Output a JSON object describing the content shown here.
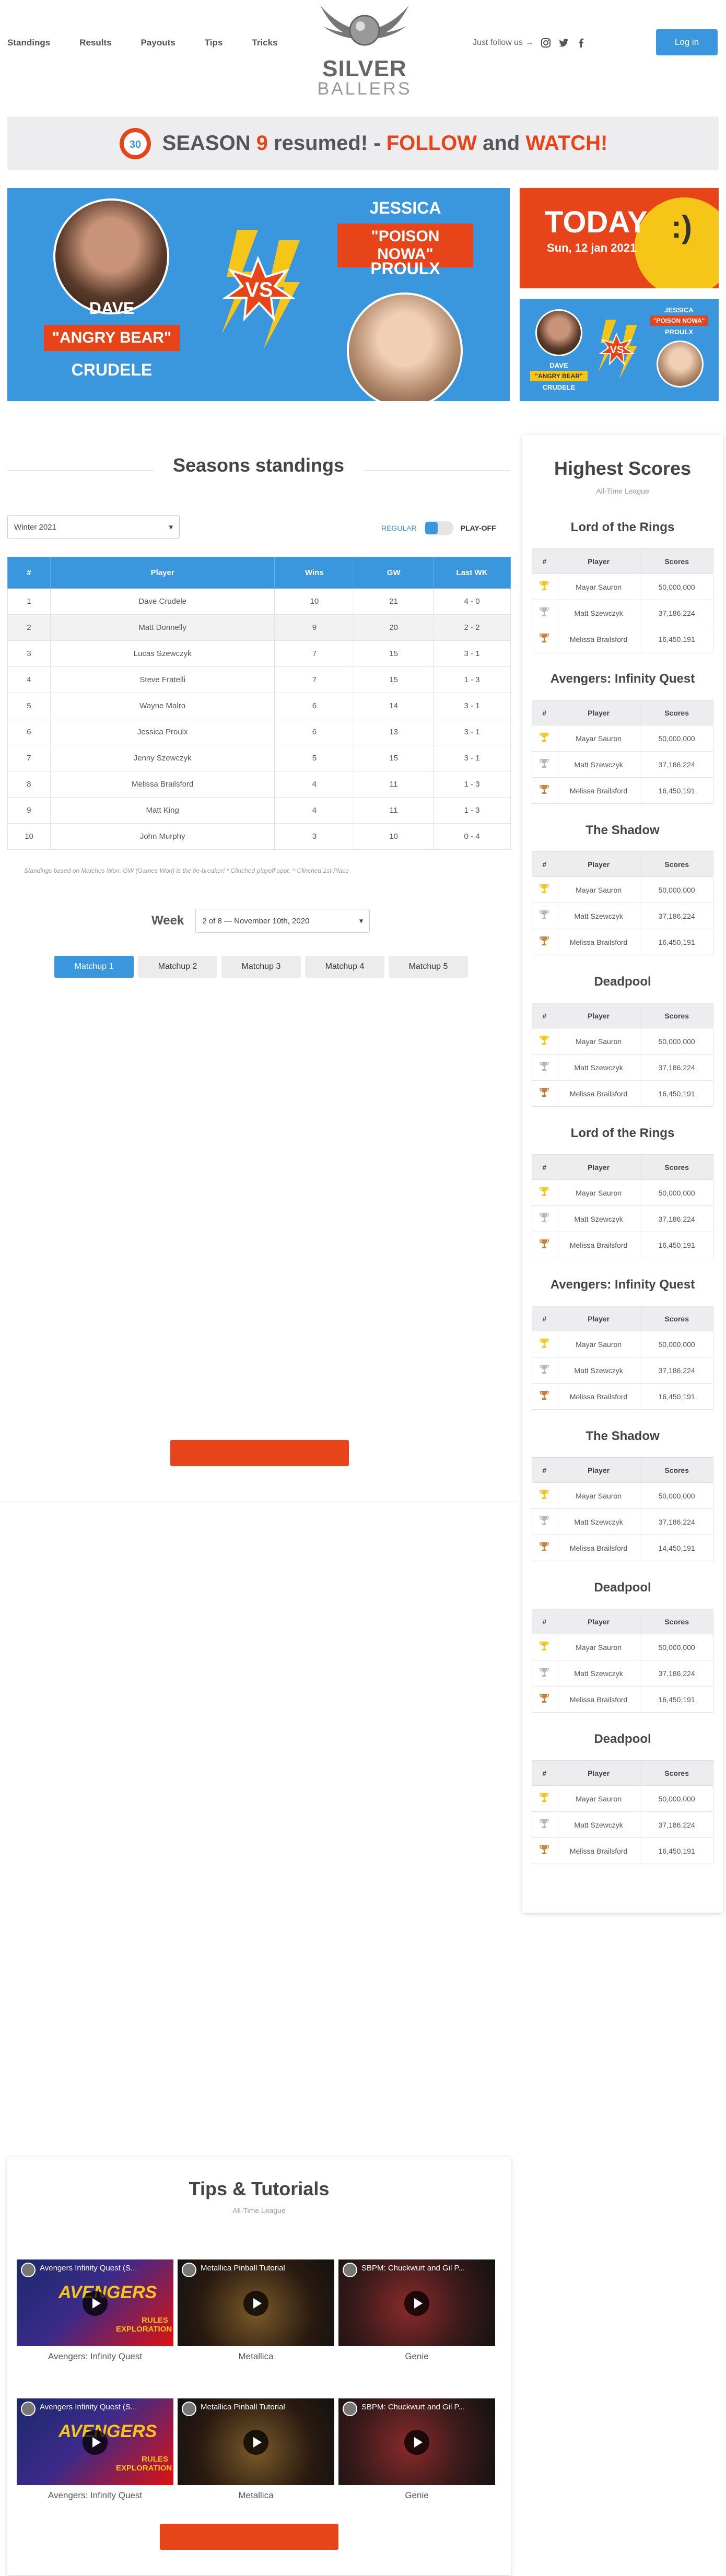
{
  "nav": {
    "items": [
      "Standings",
      "Results",
      "Payouts",
      "Tips",
      "Tricks"
    ]
  },
  "logo": {
    "line1": "SILVER",
    "line2": "BALLERS"
  },
  "header": {
    "follow_label": "Just follow us →",
    "login_label": "Log in",
    "social_icons": [
      "instagram-icon",
      "twitter-icon",
      "facebook-icon"
    ]
  },
  "season": {
    "badge": "30",
    "text_a": "SEASON ",
    "num": "9",
    "text_b": " resumed! - ",
    "follow": "FOLLOW",
    "and": " and ",
    "watch": "WATCH!"
  },
  "versus": {
    "left": {
      "first": "DAVE",
      "nick": "\"ANGRY BEAR\"",
      "last": "CRUDELE"
    },
    "right": {
      "first": "JESSICA",
      "nick": "\"POISON NOWA\"",
      "last": "PROULX"
    },
    "vs": "VS"
  },
  "today": {
    "title": "TODAY",
    "face": ":)",
    "date": "Sun, 12 jan 2021"
  },
  "standings": {
    "title": "Seasons standings",
    "season_select": "Winter 2021",
    "toggle_regular": "REGULAR",
    "toggle_playoff": "PLAY-OFF",
    "columns": [
      "#",
      "Player",
      "Wins",
      "GW",
      "Last WK"
    ],
    "rows": [
      [
        "1",
        "Dave Crudele",
        "10",
        "21",
        "4 - 0"
      ],
      [
        "2",
        "Matt Donnelly",
        "9",
        "20",
        "2 - 2"
      ],
      [
        "3",
        "Lucas Szewczyk",
        "7",
        "15",
        "3 - 1"
      ],
      [
        "4",
        "Steve Fratelli",
        "7",
        "15",
        "1 - 3"
      ],
      [
        "5",
        "Wayne Malro",
        "6",
        "14",
        "3 - 1"
      ],
      [
        "6",
        "Jessica Proulx",
        "6",
        "13",
        "3 - 1"
      ],
      [
        "7",
        "Jenny Szewczyk",
        "5",
        "15",
        "3 - 1"
      ],
      [
        "8",
        "Melissa Brailsford",
        "4",
        "11",
        "1 - 3"
      ],
      [
        "9",
        "Matt King",
        "4",
        "11",
        "1 - 3"
      ],
      [
        "10",
        "John Murphy",
        "3",
        "10",
        "0 - 4"
      ]
    ],
    "note": "Standings based on Matches Won. GW (Games Won) is the tie-breaker! * Clinched playoff spot, ^ Clinched 1st Place",
    "week_label": "Week",
    "week_select": "2 of 8 — November 10th, 2020",
    "matchups": [
      "Matchup 1",
      "Matchup 2",
      "Matchup 3",
      "Matchup 4",
      "Matchup 5"
    ]
  },
  "highest_scores": {
    "title": "Highest Scores",
    "subtitle": "All-Time League",
    "columns": [
      "#",
      "Player",
      "Scores"
    ],
    "games": [
      {
        "name": "Lord of the Rings",
        "rows": [
          [
            "Mayar Sauron",
            "50,000,000"
          ],
          [
            "Matt Szewczyk",
            "37,186,224"
          ],
          [
            "Melissa Brailsford",
            "16,450,191"
          ]
        ]
      },
      {
        "name": "Avengers: Infinity Quest",
        "rows": [
          [
            "Mayar Sauron",
            "50,000,000"
          ],
          [
            "Matt Szewczyk",
            "37,186,224"
          ],
          [
            "Melissa Brailsford",
            "16,450,191"
          ]
        ]
      },
      {
        "name": "The Shadow",
        "rows": [
          [
            "Mayar Sauron",
            "50,000,000"
          ],
          [
            "Matt Szewczyk",
            "37,186,224"
          ],
          [
            "Melissa Brailsford",
            "16,450,191"
          ]
        ]
      },
      {
        "name": "Deadpool",
        "rows": [
          [
            "Mayar Sauron",
            "50,000,000"
          ],
          [
            "Matt Szewczyk",
            "37,186,224"
          ],
          [
            "Melissa Brailsford",
            "16,450,191"
          ]
        ]
      },
      {
        "name": "Lord of the Rings",
        "rows": [
          [
            "Mayar Sauron",
            "50,000,000"
          ],
          [
            "Matt Szewczyk",
            "37,186,224"
          ],
          [
            "Melissa Brailsford",
            "16,450,191"
          ]
        ]
      },
      {
        "name": "Avengers: Infinity Quest",
        "rows": [
          [
            "Mayar Sauron",
            "50,000,000"
          ],
          [
            "Matt Szewczyk",
            "37,186,224"
          ],
          [
            "Melissa Brailsford",
            "16,450,191"
          ]
        ]
      },
      {
        "name": "The Shadow",
        "rows": [
          [
            "Mayar Sauron",
            "50,000,000"
          ],
          [
            "Matt Szewczyk",
            "37,186,224"
          ],
          [
            "Melissa Brailsford",
            "14,450,191"
          ]
        ]
      },
      {
        "name": "Deadpool",
        "rows": [
          [
            "Mayar Sauron",
            "50,000,000"
          ],
          [
            "Matt Szewczyk",
            "37,186,224"
          ],
          [
            "Melissa Brailsford",
            "16,450,191"
          ]
        ]
      },
      {
        "name": "Deadpool",
        "rows": [
          [
            "Mayar Sauron",
            "50,000,000"
          ],
          [
            "Matt Szewczyk",
            "37,186,224"
          ],
          [
            "Melissa Brailsford",
            "16,450,191"
          ]
        ]
      }
    ]
  },
  "tips": {
    "title": "Tips & Tutorials",
    "subtitle": "All-Time League",
    "videos": [
      {
        "thumb_title": "Avengers Infinity Quest (S...",
        "caption": "Avengers: Infinity Quest",
        "thumb_text": "AVENGERS",
        "thumb_sub": "RULES EXPLORATION"
      },
      {
        "thumb_title": "Metallica Pinball Tutorial",
        "caption": "Metallica",
        "thumb_text": "",
        "thumb_sub": ""
      },
      {
        "thumb_title": "SBPM: Chuckwurt and Gil P...",
        "caption": "Genie",
        "thumb_text": "",
        "thumb_sub": ""
      },
      {
        "thumb_title": "Avengers Infinity Quest (S...",
        "caption": "Avengers: Infinity Quest",
        "thumb_text": "AVENGERS",
        "thumb_sub": "RULES EXPLORATION"
      },
      {
        "thumb_title": "Metallica Pinball Tutorial",
        "caption": "Metallica",
        "thumb_text": "",
        "thumb_sub": ""
      },
      {
        "thumb_title": "SBPM: Chuckwurt and Gil P...",
        "caption": "Genie",
        "thumb_text": "",
        "thumb_sub": ""
      }
    ]
  },
  "colors": {
    "accent": "#3a96dd",
    "orange": "#e8441a",
    "yellow": "#f5c518"
  }
}
